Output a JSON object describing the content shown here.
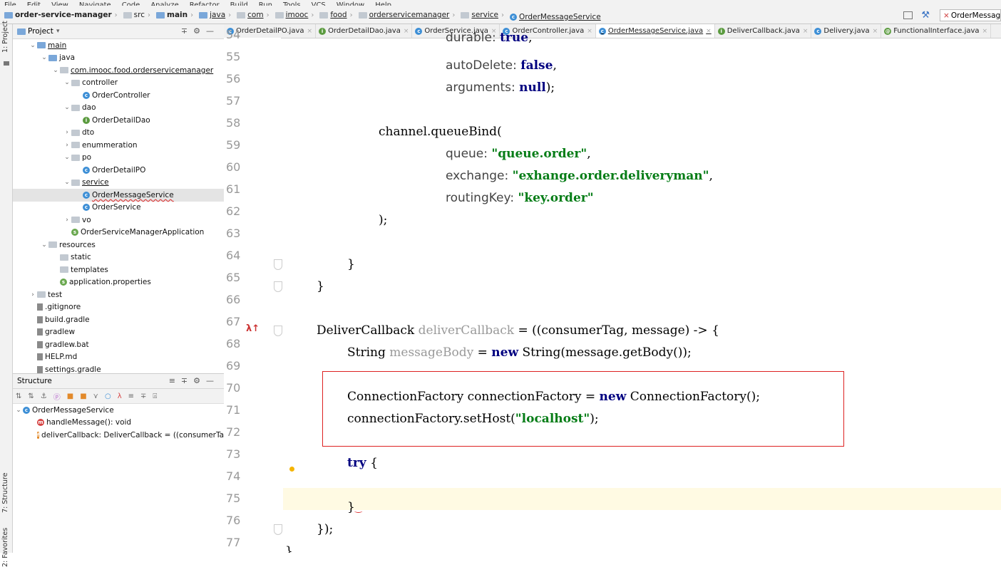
{
  "menu": [
    "File",
    "Edit",
    "View",
    "Navigate",
    "Code",
    "Analyze",
    "Refactor",
    "Build",
    "Run",
    "Tools",
    "VCS",
    "Window",
    "Help"
  ],
  "breadcrumb": [
    "order-service-manager",
    "src",
    "main",
    "java",
    "com",
    "imooc",
    "food",
    "orderservicemanager",
    "service",
    "OrderMessageService"
  ],
  "run_config": "OrderMessag",
  "left_tabs": {
    "project": "1: Project",
    "structure": "7: Structure",
    "favorites": "2: Favorites"
  },
  "project_panel": {
    "title": "Project",
    "tree": [
      {
        "label": "main",
        "depth": 0,
        "arrow": "v",
        "icon": "folder-blue",
        "u": true
      },
      {
        "label": "java",
        "depth": 1,
        "arrow": "v",
        "icon": "folder-blue"
      },
      {
        "label": "com.imooc.food.orderservicemanager",
        "depth": 2,
        "arrow": "v",
        "icon": "folder",
        "u": true
      },
      {
        "label": "controller",
        "depth": 3,
        "arrow": "v",
        "icon": "folder"
      },
      {
        "label": "OrderController",
        "depth": 4,
        "arrow": "",
        "icon": "class"
      },
      {
        "label": "dao",
        "depth": 3,
        "arrow": "v",
        "icon": "folder"
      },
      {
        "label": "OrderDetailDao",
        "depth": 4,
        "arrow": "",
        "icon": "interface"
      },
      {
        "label": "dto",
        "depth": 3,
        "arrow": ">",
        "icon": "folder"
      },
      {
        "label": "enummeration",
        "depth": 3,
        "arrow": ">",
        "icon": "folder"
      },
      {
        "label": "po",
        "depth": 3,
        "arrow": "v",
        "icon": "folder"
      },
      {
        "label": "OrderDetailPO",
        "depth": 4,
        "arrow": "",
        "icon": "class"
      },
      {
        "label": "service",
        "depth": 3,
        "arrow": "v",
        "icon": "folder",
        "u": true
      },
      {
        "label": "OrderMessageService",
        "depth": 4,
        "arrow": "",
        "icon": "class",
        "sel": true,
        "wavy": true
      },
      {
        "label": "OrderService",
        "depth": 4,
        "arrow": "",
        "icon": "class"
      },
      {
        "label": "vo",
        "depth": 3,
        "arrow": ">",
        "icon": "folder"
      },
      {
        "label": "OrderServiceManagerApplication",
        "depth": 3,
        "arrow": "",
        "icon": "spring"
      },
      {
        "label": "resources",
        "depth": 1,
        "arrow": "v",
        "icon": "folder"
      },
      {
        "label": "static",
        "depth": 2,
        "arrow": "",
        "icon": "folder"
      },
      {
        "label": "templates",
        "depth": 2,
        "arrow": "",
        "icon": "folder"
      },
      {
        "label": "application.properties",
        "depth": 2,
        "arrow": "",
        "icon": "spring"
      },
      {
        "label": "test",
        "depth": 0,
        "arrow": ">",
        "icon": "folder"
      },
      {
        "label": ".gitignore",
        "depth": -1,
        "arrow": "",
        "icon": "file"
      },
      {
        "label": "build.gradle",
        "depth": -1,
        "arrow": "",
        "icon": "file"
      },
      {
        "label": "gradlew",
        "depth": -1,
        "arrow": "",
        "icon": "file"
      },
      {
        "label": "gradlew.bat",
        "depth": -1,
        "arrow": "",
        "icon": "file"
      },
      {
        "label": "HELP.md",
        "depth": -1,
        "arrow": "",
        "icon": "file"
      },
      {
        "label": "settings.gradle",
        "depth": -1,
        "arrow": "",
        "icon": "file"
      }
    ]
  },
  "structure_panel": {
    "title": "Structure",
    "items": [
      {
        "label": "OrderMessageService",
        "depth": 0,
        "icon": "class"
      },
      {
        "label": "handleMessage(): void",
        "depth": 1,
        "icon": "method"
      },
      {
        "label": "deliverCallback: DeliverCallback = ((consumerTa",
        "depth": 1,
        "icon": "field"
      }
    ]
  },
  "tabs": [
    {
      "label": "OrderDetailPO.java",
      "icon": "class"
    },
    {
      "label": "OrderDetailDao.java",
      "icon": "interface"
    },
    {
      "label": "OrderService.java",
      "icon": "class"
    },
    {
      "label": "OrderController.java",
      "icon": "class"
    },
    {
      "label": "OrderMessageService.java",
      "icon": "class",
      "active": true
    },
    {
      "label": "DeliverCallback.java",
      "icon": "interface"
    },
    {
      "label": "Delivery.java",
      "icon": "class"
    },
    {
      "label": "FunctionalInterface.java",
      "icon": "annotation"
    }
  ],
  "line_numbers": [
    "54",
    "55",
    "56",
    "57",
    "58",
    "59",
    "60",
    "61",
    "62",
    "63",
    "64",
    "65",
    "66",
    "67",
    "68",
    "69",
    "70",
    "71",
    "72",
    "73",
    "74",
    "75",
    "76",
    "77"
  ],
  "code": {
    "l54": [
      "durable: ",
      "true",
      ","
    ],
    "l55": [
      "autoDelete: ",
      "false",
      ","
    ],
    "l56": [
      "arguments: ",
      "null",
      ");"
    ],
    "l58": "channel.queueBind(",
    "l59": [
      "queue: ",
      "\"queue.order\"",
      ","
    ],
    "l60": [
      "exchange: ",
      "\"exhange.order.deliveryman\"",
      ","
    ],
    "l61": [
      "routingKey: ",
      "\"key.order\""
    ],
    "l62": ");",
    "l64": "}",
    "l65": "}",
    "l67": [
      "DeliverCallback ",
      "deliverCallback",
      " = ((consumerTag, message) -> {"
    ],
    "l68": [
      "String ",
      "messageBody",
      " = ",
      "new",
      " String(message.getBody());"
    ],
    "l70": [
      "ConnectionFactory connectionFactory = ",
      "new",
      " ConnectionFactory();"
    ],
    "l71": [
      "connectionFactory.setHost(",
      "\"localhost\"",
      ");"
    ],
    "l73": [
      "try",
      " {"
    ],
    "l75": "}",
    "l76": "});",
    "l77": "}"
  }
}
